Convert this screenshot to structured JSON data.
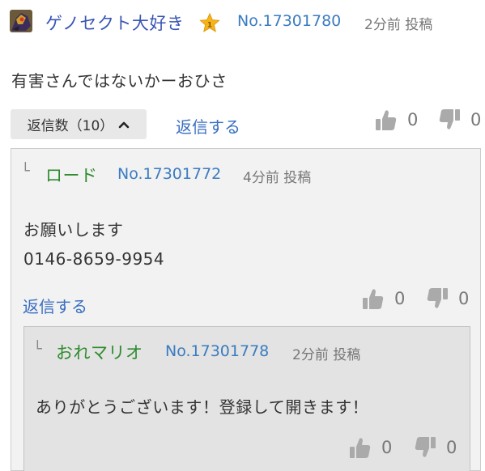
{
  "post": {
    "username": "ゲノセクト大好き",
    "rank_badge": "1",
    "post_no": "No.17301780",
    "time": "2分前 投稿",
    "body": "有害さんではないかーおひさ",
    "reply_count": "返信数（10）",
    "reply_link": "返信する",
    "likes": "0",
    "dislikes": "0"
  },
  "comments": [
    {
      "tree_mark": "└",
      "username": "ロード",
      "post_no": "No.17301772",
      "time": "4分前 投稿",
      "body_line1": "お願いします",
      "body_line2": "0146-8659-9954",
      "reply_link": "返信する",
      "likes": "0",
      "dislikes": "0"
    },
    {
      "tree_mark": "└",
      "username": "おれマリオ",
      "post_no": "No.17301778",
      "time": "2分前 投稿",
      "body": "ありがとうございます！登録して開きます！",
      "likes": "0",
      "dislikes": "0"
    }
  ],
  "icons": {
    "avatar": "genesect-avatar",
    "rank": "star-rank-icon",
    "like": "thumbs-up-icon",
    "dislike": "thumbs-down-icon",
    "collapse": "chevron-up-icon"
  },
  "colors": {
    "username_main": "#3a55b4",
    "username_reply": "#2e8b2e",
    "link": "#3a6fc0",
    "post_no": "#3a7cc0",
    "muted": "#777777",
    "box1_bg": "#f2f2f2",
    "box2_bg": "#e3e3e3"
  }
}
